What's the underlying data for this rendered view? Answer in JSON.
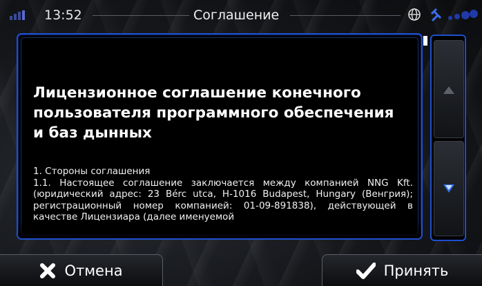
{
  "status_bar": {
    "time": "13:52",
    "title": "Соглашение",
    "globe_icon": "globe-icon",
    "gps_icon": "satellite-icon"
  },
  "document": {
    "title": "Лицензионное соглашение конечного пользователя программного обеспечения и баз дынных",
    "section_heading": "1. Стороны соглашения",
    "paragraph": "1.1. Настоящее соглашение заключается между компанией NNG Kft. (юридический адрес: 23 Bérc utca, H-1016 Budapest, Hungary (Венгрия); регистрационный номер компанией: 01-09-891838), действующей в качестве Лицензиара (далее именуемой"
  },
  "scrollbar": {
    "up_icon": "arrow-up-icon",
    "down_icon": "arrow-down-icon"
  },
  "buttons": {
    "cancel_label": "Отмена",
    "accept_label": "Принять"
  },
  "colors": {
    "accent_blue": "#1e4fd0",
    "background": "#15171b"
  }
}
